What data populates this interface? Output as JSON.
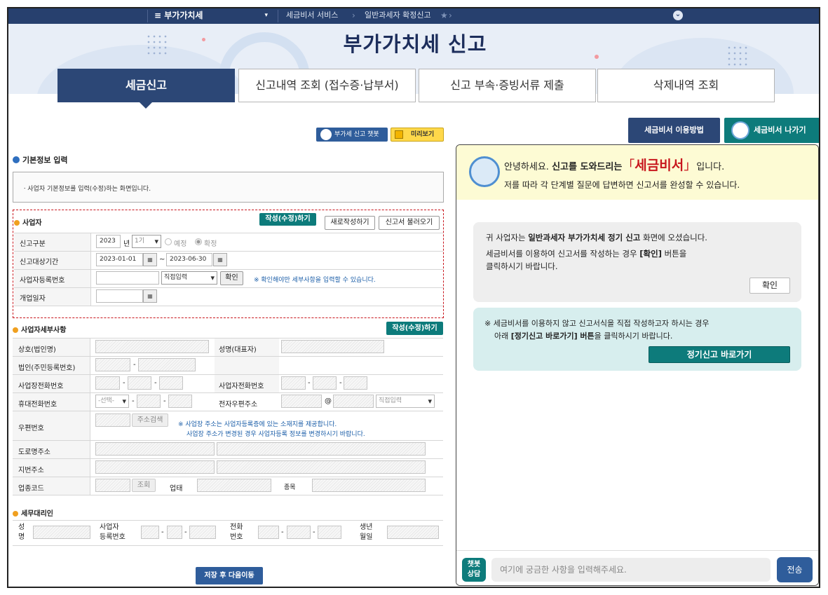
{
  "nav": {
    "menu": "≡ 부가가치세",
    "crumb1": "세금비서 서비스",
    "crumb2": "일반과세자 확정신고",
    "star": "★",
    "chev": "⌄"
  },
  "page": {
    "title": "부가가치세 신고"
  },
  "tabs": [
    "세금신고",
    "신고내역 조회 (접수증·납부서)",
    "신고 부속·증빙서류 제출",
    "삭제내역 조회"
  ],
  "toolbar": {
    "chatbot": "부가세 신고 챗봇",
    "preview": "미리보기",
    "guide": "세금비서 이용방법",
    "exit": "세금비서 나가기"
  },
  "basic": {
    "title": "기본정보 입력",
    "desc": "ㆍ사업자 기본정보를 입력(수정)하는 화면입니다."
  },
  "biz": {
    "title": "사업자",
    "btn_edit": "작성(수정)하기",
    "btn_new": "새로작성하기",
    "btn_load": "신고서 불러오기",
    "l_type": "신고구분",
    "year": "2023",
    "year_unit": "년",
    "period": "1기",
    "radio1": "예정",
    "radio2": "확정",
    "l_period": "신고대상기간",
    "date_from": "2023-01-01",
    "tilde": "~",
    "date_to": "2023-06-30",
    "l_regno": "사업자등록번호",
    "direct": "직접입력",
    "confirm": "확인",
    "note": "※ 확인해야만 세부사항을 입력할 수 있습니다.",
    "l_open": "개업일자",
    "cal": "▦"
  },
  "detail": {
    "title": "사업자세부사항",
    "btn_edit": "작성(수정)하기",
    "l_name": "상호(법인명)",
    "l_rep": "성명(대표자)",
    "l_corp": "법인(주민등록번호)",
    "l_bizphone": "사업장전화번호",
    "l_bizphone2": "사업자전화번호",
    "l_mobile": "휴대전화번호",
    "mobile_sel": "-선택-",
    "l_email": "전자우편주소",
    "at": "@",
    "direct": "직접입력",
    "l_zip": "우편번호",
    "addr_search": "주소검색",
    "zip_note1": "※ 사업장 주소는 사업자등록증에 있는 소재지를 제공합니다.",
    "zip_note2": "사업장 주소가 변경된 경우 사업자등록 정보를 변경하시기 바랍니다.",
    "l_road": "도로명주소",
    "l_lot": "지번주소",
    "l_code": "업종코드",
    "lookup": "조회",
    "l_biztype": "업태",
    "l_item": "종목",
    "dash": "-"
  },
  "agent": {
    "title": "세무대리인",
    "l_name1": "성",
    "l_name2": "명",
    "l_reg1": "사업자",
    "l_reg2": "등록번호",
    "l_tel1": "전화",
    "l_tel2": "번호",
    "l_birth1": "생년",
    "l_birth2": "월일"
  },
  "save": "저장 후 다음이동",
  "chat": {
    "greet_a": "안녕하세요.",
    "greet_b": "신고를 도와드리는",
    "lq": "「",
    "brand": "세금비서",
    "rq": "」",
    "greet_c": "입니다.",
    "guide": "저를 따라 각 단계별 질문에 답변하면 신고서를 완성할 수 있습니다.",
    "m1_a": "귀 사업자는",
    "m1_b": "일반과세자 부가가치세 정기 신고",
    "m1_c": "화면에 오셨습니다.",
    "m1_d": "세금비서를 이용하여 신고서를 작성하는 경우",
    "m1_e": "[확인]",
    "m1_f": "버튼을",
    "m1_g": "클릭하시기 바랍니다.",
    "confirm": "확인",
    "m2_a": "※ 세금비서를 이용하지 않고 신고서식을 직접 작성하고자 하시는 경우",
    "m2_b": "아래",
    "m2_c": "[정기신고 바로가기] 버튼",
    "m2_d": "을 클릭하시기 바랍니다.",
    "goto": "정기신고 바로가기",
    "tag1": "챗봇",
    "tag2": "상담",
    "placeholder": "여기에 궁금한 사항을 입력해주세요.",
    "send": "전송"
  },
  "colors": {
    "navy": "#27406e",
    "teal": "#0d7b7b",
    "chatyellow": "#fdfbd4",
    "brandred": "#c8161d"
  }
}
